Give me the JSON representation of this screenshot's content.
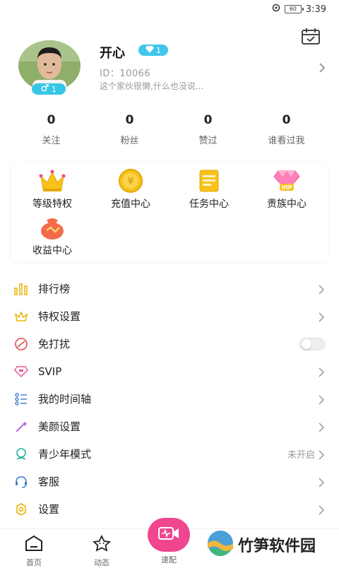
{
  "status_bar": {
    "battery": "60",
    "time": "3:39"
  },
  "profile": {
    "nickname": "开心",
    "level": "1",
    "gender_level": "1",
    "user_id": "ID：10066",
    "signature": "这个家伙很懒,什么也没说..."
  },
  "stats": [
    {
      "value": "0",
      "label": "关注"
    },
    {
      "value": "0",
      "label": "粉丝"
    },
    {
      "value": "0",
      "label": "赞过"
    },
    {
      "value": "0",
      "label": "谁看过我"
    }
  ],
  "features": [
    {
      "label": "等级特权",
      "icon": "crown-icon"
    },
    {
      "label": "充值中心",
      "icon": "coin-icon"
    },
    {
      "label": "任务中心",
      "icon": "task-icon"
    },
    {
      "label": "贵族中心",
      "icon": "vip-diamond-icon"
    },
    {
      "label": "收益中心",
      "icon": "money-bag-icon"
    }
  ],
  "menu": [
    {
      "label": "排行榜",
      "icon": "ranking-icon"
    },
    {
      "label": "特权设置",
      "icon": "privilege-icon"
    },
    {
      "label": "免打扰",
      "icon": "do-not-disturb-icon",
      "toggle": false
    },
    {
      "label": "SVIP",
      "icon": "svip-icon"
    },
    {
      "label": "我的时间轴",
      "icon": "timeline-icon"
    },
    {
      "label": "美颜设置",
      "icon": "beauty-wand-icon"
    },
    {
      "label": "青少年模式",
      "icon": "youth-mode-icon",
      "value": "未开启"
    },
    {
      "label": "客服",
      "icon": "customer-service-icon"
    },
    {
      "label": "设置",
      "icon": "settings-icon"
    }
  ],
  "tabbar": {
    "home": "首页",
    "moments": "动态",
    "match": "速配"
  },
  "watermark": "竹笋软件园",
  "colors": {
    "accent_blue": "#36c7e6",
    "match_pink": "#f0468f",
    "gold": "#f5b800"
  }
}
